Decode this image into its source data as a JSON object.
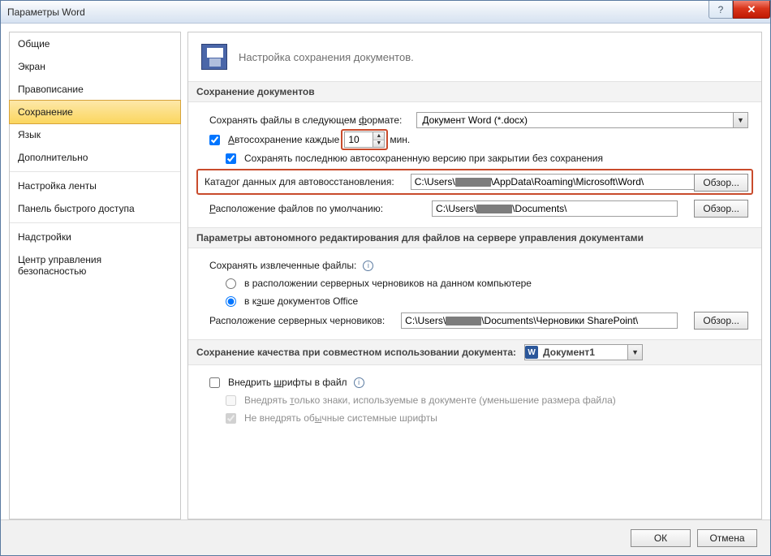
{
  "title": "Параметры Word",
  "sidebar": {
    "items": [
      "Общие",
      "Экран",
      "Правописание",
      "Сохранение",
      "Язык",
      "Дополнительно",
      "Настройка ленты",
      "Панель быстрого доступа",
      "Надстройки",
      "Центр управления безопасностью"
    ],
    "selected_index": 3
  },
  "header_text": "Настройка сохранения документов.",
  "section1": {
    "title": "Сохранение документов",
    "format_label_pre": "Сохранять файлы в следующем ",
    "format_label_u": "ф",
    "format_label_post": "ормате:",
    "format_value": "Документ Word (*.docx)",
    "autosave_checked": true,
    "autosave_label_u": "А",
    "autosave_label_post": "втосохранение каждые",
    "autosave_interval": "10",
    "autosave_unit": "мин.",
    "keeplast_checked": true,
    "keeplast_label": "Сохранять последнюю автосохраненную версию при закрытии без сохранения",
    "recover_label_pre": "Ката",
    "recover_label_u": "л",
    "recover_label_post": "ог данных для автовосстановления:",
    "recover_path_a": "C:\\Users\\",
    "recover_path_b": "\\AppData\\Roaming\\Microsoft\\Word\\",
    "default_label_u": "Р",
    "default_label_post": "асположение файлов по умолчанию:",
    "default_path_a": "C:\\Users\\",
    "default_path_b": "\\Documents\\",
    "browse_label": "Обзор..."
  },
  "section2": {
    "title": "Параметры автономного редактирования для файлов на сервере управления документами",
    "save_checked_label": "Сохранять извлеченные файлы:",
    "opt_server": "в расположении серверных черновиков на данном компьютере",
    "opt_cache_pre": "в к",
    "opt_cache_u": "э",
    "opt_cache_post": "ше документов Office",
    "cache_selected": true,
    "drafts_label": "Расположение серверных черновиков:",
    "drafts_path_a": "C:\\Users\\",
    "drafts_path_b": "\\Documents\\Черновики SharePoint\\",
    "browse_label_u": "О",
    "browse_label_post": "бзор..."
  },
  "section3": {
    "title_pre": "Со",
    "title_u": "х",
    "title_post": "ранение качества при совместном использовании документа:",
    "doc_value": "Документ1",
    "embed_checked": false,
    "embed_label_pre": "Внедрить ",
    "embed_label_u": "ш",
    "embed_label_post": "рифты в файл",
    "only_used_pre": "Внедрять ",
    "only_used_u": "т",
    "only_used_post": "олько знаки, используемые в документе (уменьшение размера файла)",
    "no_common_pre": "Не внедрять об",
    "no_common_u": "ы",
    "no_common_post": "чные системные шрифты"
  },
  "footer": {
    "ok": "ОК",
    "cancel": "Отмена"
  }
}
